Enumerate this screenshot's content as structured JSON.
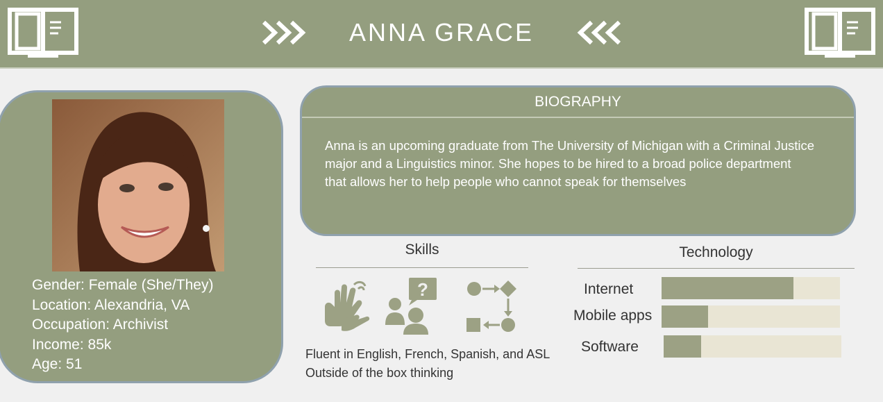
{
  "header": {
    "title": "ANNA GRACE",
    "left_icon": "book-icon",
    "right_icon": "book-icon",
    "color": "#949e7f"
  },
  "profile": {
    "photo_icon": "portrait-photo",
    "gender": "Gender: Female (She/They)",
    "location": "Location:  Alexandria, VA",
    "occupation": "Occupation: Archivist",
    "income": "Income: 85k",
    "age": "Age: 51"
  },
  "biography": {
    "title": "BIOGRAPHY",
    "lines": [
      "Anna is an upcoming graduate from The University of Michigan with a Criminal Justice",
      "major and a Linguistics minor. She hopes to be hired to a broad police department",
      "that allows her to help people who cannot speak for themselves"
    ]
  },
  "skills": {
    "title": "Skills",
    "icons": [
      "sign-language-icon",
      "people-question-icon",
      "flowchart-icon"
    ],
    "items": [
      "Fluent in English, French, Spanish, and ASL",
      "Outside of the box thinking"
    ]
  },
  "technology": {
    "title": "Technology",
    "items": [
      {
        "label": "Internet",
        "level": 0.74
      },
      {
        "label": "Mobile apps",
        "level": 0.26
      },
      {
        "label": "Software",
        "level": 0.21
      }
    ]
  }
}
